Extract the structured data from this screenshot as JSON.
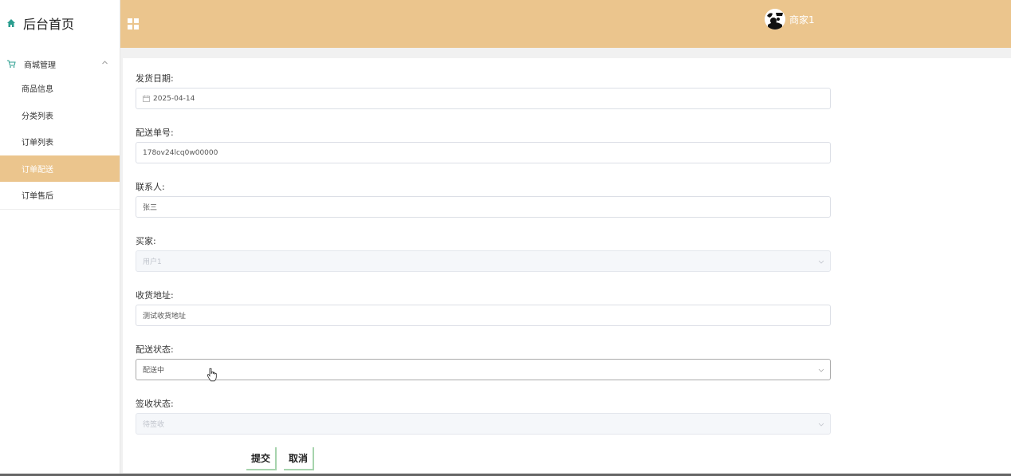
{
  "sidebar": {
    "brand_label": "后台首页",
    "group_label": "商城管理",
    "items": [
      {
        "label": "商品信息"
      },
      {
        "label": "分类列表"
      },
      {
        "label": "订单列表"
      },
      {
        "label": "订单配送"
      },
      {
        "label": "订单售后"
      }
    ],
    "active_item": "订单配送"
  },
  "header": {
    "user_name": "商家1"
  },
  "form": {
    "ship_date": {
      "label": "发货日期:",
      "value": "2025-04-14"
    },
    "tracking_no": {
      "label": "配送单号:",
      "value": "178ov24lcq0w00000"
    },
    "contact": {
      "label": "联系人:",
      "value": "张三"
    },
    "buyer": {
      "label": "买家:",
      "value": "用户1"
    },
    "address": {
      "label": "收货地址:",
      "value": "测试收货地址"
    },
    "delivery_status": {
      "label": "配送状态:",
      "value": "配送中"
    },
    "sign_status": {
      "label": "签收状态:",
      "value": "待签收"
    },
    "submit_label": "提交",
    "cancel_label": "取消"
  },
  "colors": {
    "accent": "#ebc58d",
    "button_border": "#a6d4ad",
    "home_icon": "#2a9d8f"
  },
  "icons": [
    "home-icon",
    "cart-icon",
    "chevron-up-icon",
    "grid-icon",
    "avatar",
    "calendar-icon",
    "chevron-down-icon",
    "hand-cursor-icon"
  ]
}
